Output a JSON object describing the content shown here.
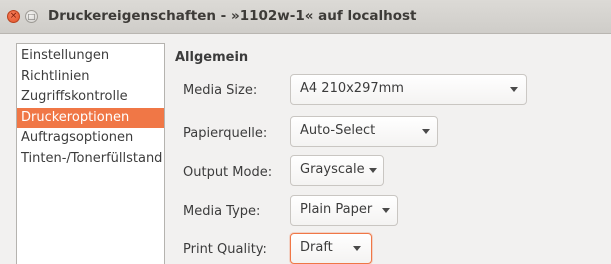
{
  "window": {
    "title": "Druckereigenschaften - »1102w-1« auf localhost",
    "close_glyph": "×",
    "minimize_glyph": "□"
  },
  "sidebar": {
    "items": [
      {
        "label": "Einstellungen",
        "active": false
      },
      {
        "label": "Richtlinien",
        "active": false
      },
      {
        "label": "Zugriffskontrolle",
        "active": false
      },
      {
        "label": "Druckeroptionen",
        "active": true
      },
      {
        "label": "Auftragsoptionen",
        "active": false
      },
      {
        "label": "Tinten-/Tonerfüllstand",
        "active": false
      }
    ]
  },
  "main": {
    "group_title": "Allgemein",
    "options": [
      {
        "label": "Media Size:",
        "value": "A4 210x297mm"
      },
      {
        "label": "Papierquelle:",
        "value": "Auto-Select"
      },
      {
        "label": "Output Mode:",
        "value": "Grayscale"
      },
      {
        "label": "Media Type:",
        "value": "Plain Paper"
      },
      {
        "label": "Print Quality:",
        "value": "Draft"
      }
    ]
  },
  "colors": {
    "accent": "#f07746",
    "close_button": "#e0542a"
  }
}
